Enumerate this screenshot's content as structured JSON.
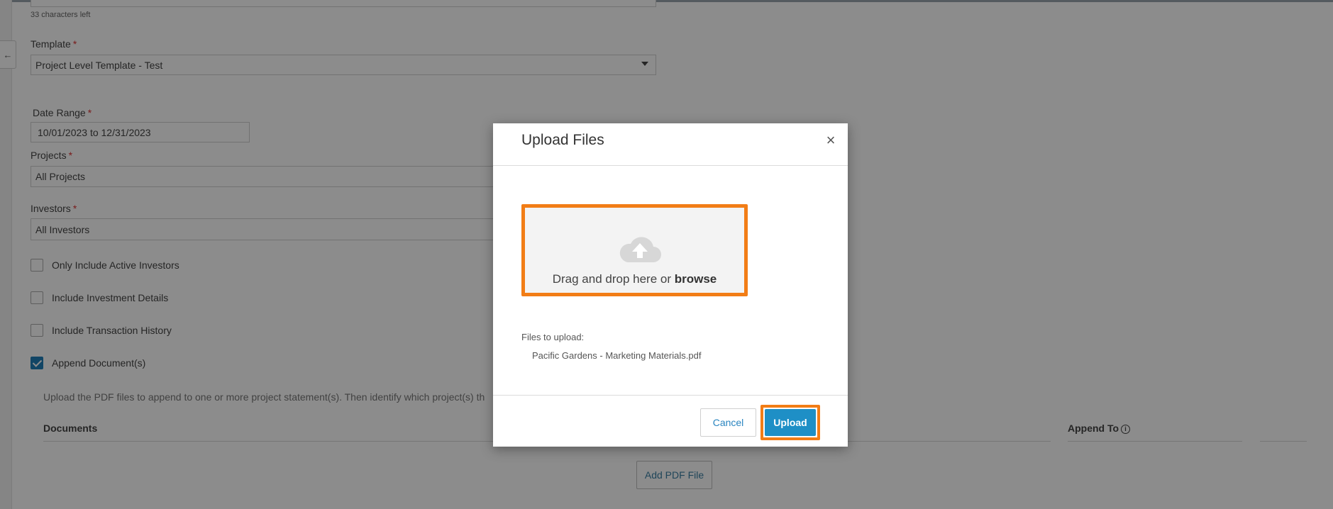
{
  "form": {
    "chars_left": "33 characters left",
    "template": {
      "label": "Template",
      "value": "Project Level Template - Test"
    },
    "date_range": {
      "label": "Date Range",
      "value": "10/01/2023 to 12/31/2023"
    },
    "projects": {
      "label": "Projects",
      "value": "All Projects"
    },
    "investors": {
      "label": "Investors",
      "value": "All Investors"
    },
    "required_mark": "*",
    "checkboxes": [
      {
        "label": "Only Include Active Investors",
        "checked": false
      },
      {
        "label": "Include Investment Details",
        "checked": false
      },
      {
        "label": "Include Transaction History",
        "checked": false
      },
      {
        "label": "Append Document(s)",
        "checked": true
      }
    ],
    "append_help": "Upload the PDF files to append to one or more project statement(s). Then identify which project(s) th",
    "documents_header": "Documents",
    "append_to_header": "Append To",
    "add_pdf_button": "Add PDF File"
  },
  "modal": {
    "title": "Upload Files",
    "close_icon": "close-icon",
    "dropzone_text": "Drag and drop here or ",
    "dropzone_browse": "browse",
    "files_label": "Files to upload:",
    "files": [
      "Pacific Gardens - Marketing Materials.pdf"
    ],
    "cancel_label": "Cancel",
    "upload_label": "Upload"
  },
  "colors": {
    "accent": "#1e8fc6",
    "highlight": "#f27d16",
    "checkbox": "#1f7fb8"
  }
}
